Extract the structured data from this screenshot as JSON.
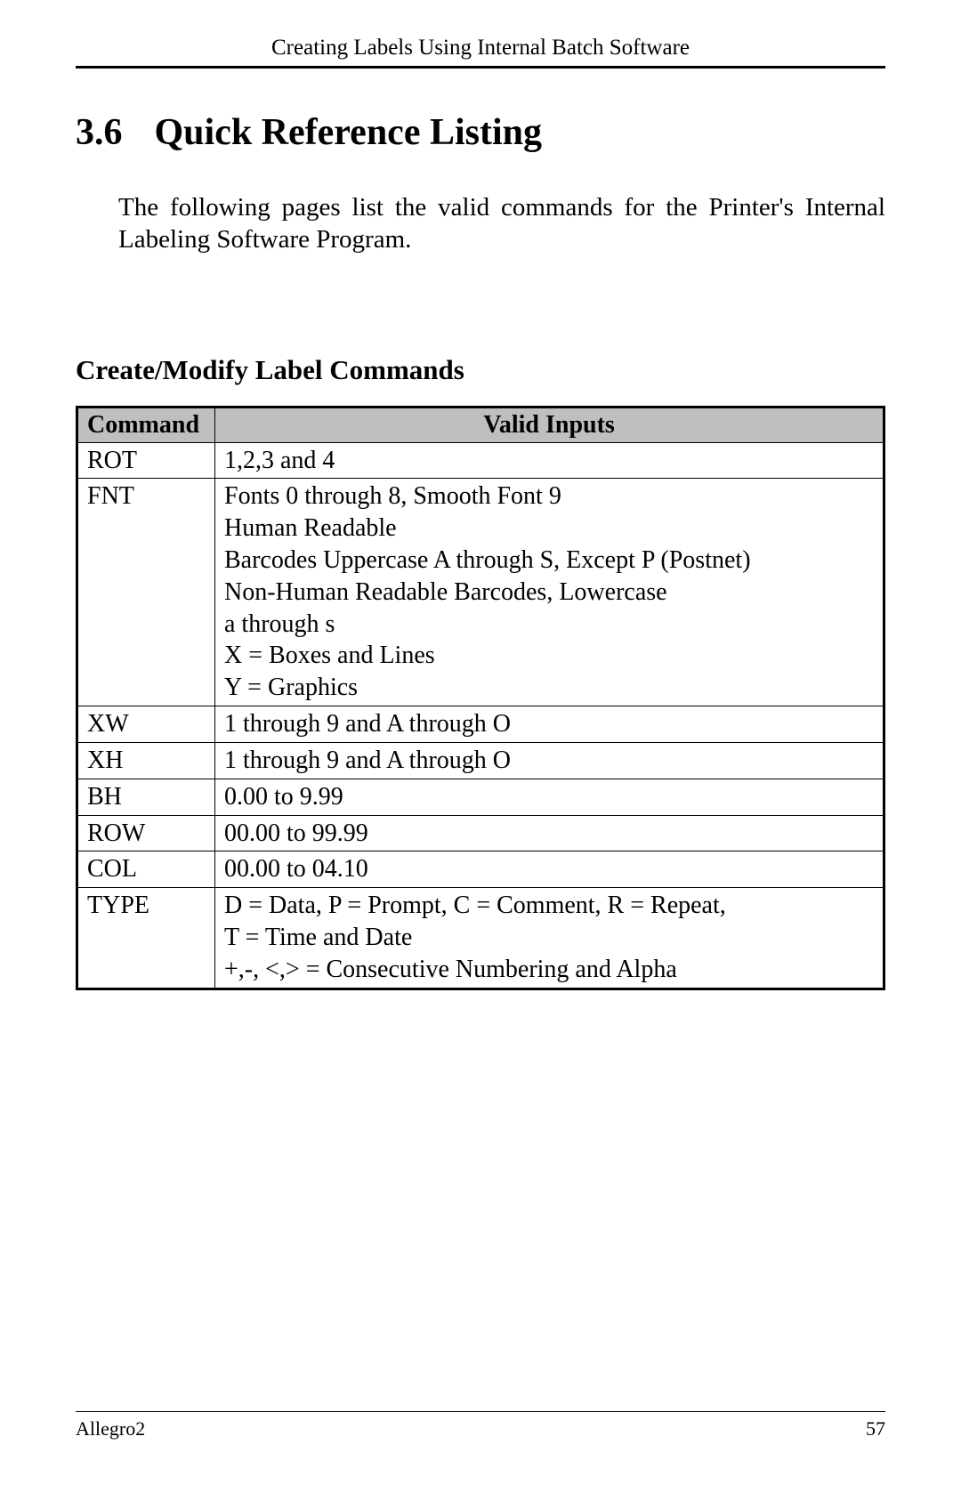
{
  "header": {
    "running_title": "Creating Labels Using Internal Batch Software"
  },
  "section": {
    "number": "3.6",
    "title": "Quick Reference Listing",
    "intro": "The following pages list the valid commands for the Printer's Internal Labeling Software Program."
  },
  "table": {
    "caption": "Create/Modify Label Commands",
    "head": {
      "c0": "Command",
      "c1": "Valid Inputs"
    },
    "rows": [
      {
        "cmd": "ROT",
        "inputs": [
          "1,2,3 and 4"
        ]
      },
      {
        "cmd": "FNT",
        "inputs": [
          "Fonts 0 through 8, Smooth Font 9",
          "Human Readable",
          "Barcodes Uppercase A through S, Except P (Postnet)",
          "Non-Human Readable Barcodes, Lowercase",
          " a through s",
          "X = Boxes and Lines",
          "Y = Graphics"
        ]
      },
      {
        "cmd": "XW",
        "inputs": [
          "1 through 9 and A through O"
        ]
      },
      {
        "cmd": "XH",
        "inputs": [
          "1 through 9 and A through O"
        ]
      },
      {
        "cmd": "BH",
        "inputs": [
          "0.00 to 9.99"
        ]
      },
      {
        "cmd": "ROW",
        "inputs": [
          "00.00 to 99.99"
        ]
      },
      {
        "cmd": "COL",
        "inputs": [
          "00.00 to 04.10"
        ]
      },
      {
        "cmd": "TYPE",
        "inputs": [
          "D = Data, P = Prompt, C = Comment, R = Repeat,",
          "T = Time and Date",
          "+,-, <,> = Consecutive Numbering and Alpha"
        ]
      }
    ]
  },
  "footer": {
    "left": "Allegro2",
    "right": "57"
  }
}
